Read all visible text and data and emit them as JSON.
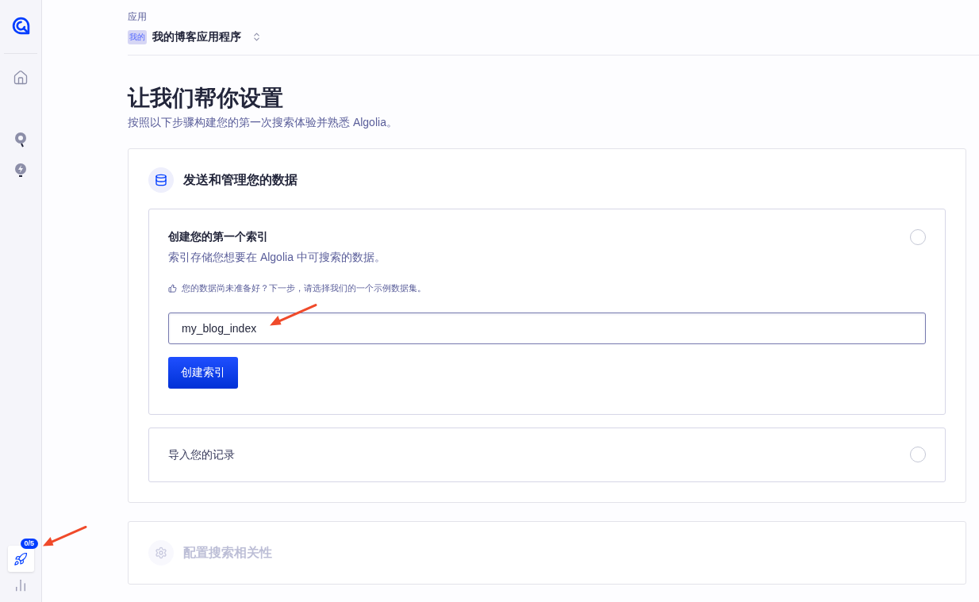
{
  "sidebar": {
    "rocket_badge": "0/5",
    "rocket_annotated": true
  },
  "header": {
    "label": "应用",
    "app_avatar": "我的",
    "app_name": "我的博客应用程序"
  },
  "title": "让我们帮你设置",
  "subtitle": "按照以下步骤构建您的第一次搜索体验并熟悉 Algolia。",
  "sections": [
    {
      "title": "发送和管理您的数据",
      "disabled": false,
      "steps": [
        {
          "title": "创建您的第一个索引",
          "expanded": true,
          "done": false,
          "description": "索引存储您想要在 Algolia 中可搜索的数据。",
          "hint": "您的数据尚未准备好？下一步，请选择我们的一个示例数据集。",
          "input_value": "my_blog_index",
          "input_annotated": true,
          "button": "创建索引"
        },
        {
          "title": "导入您的记录",
          "expanded": false,
          "done": false
        }
      ]
    },
    {
      "title": "配置搜索相关性",
      "disabled": true
    }
  ]
}
